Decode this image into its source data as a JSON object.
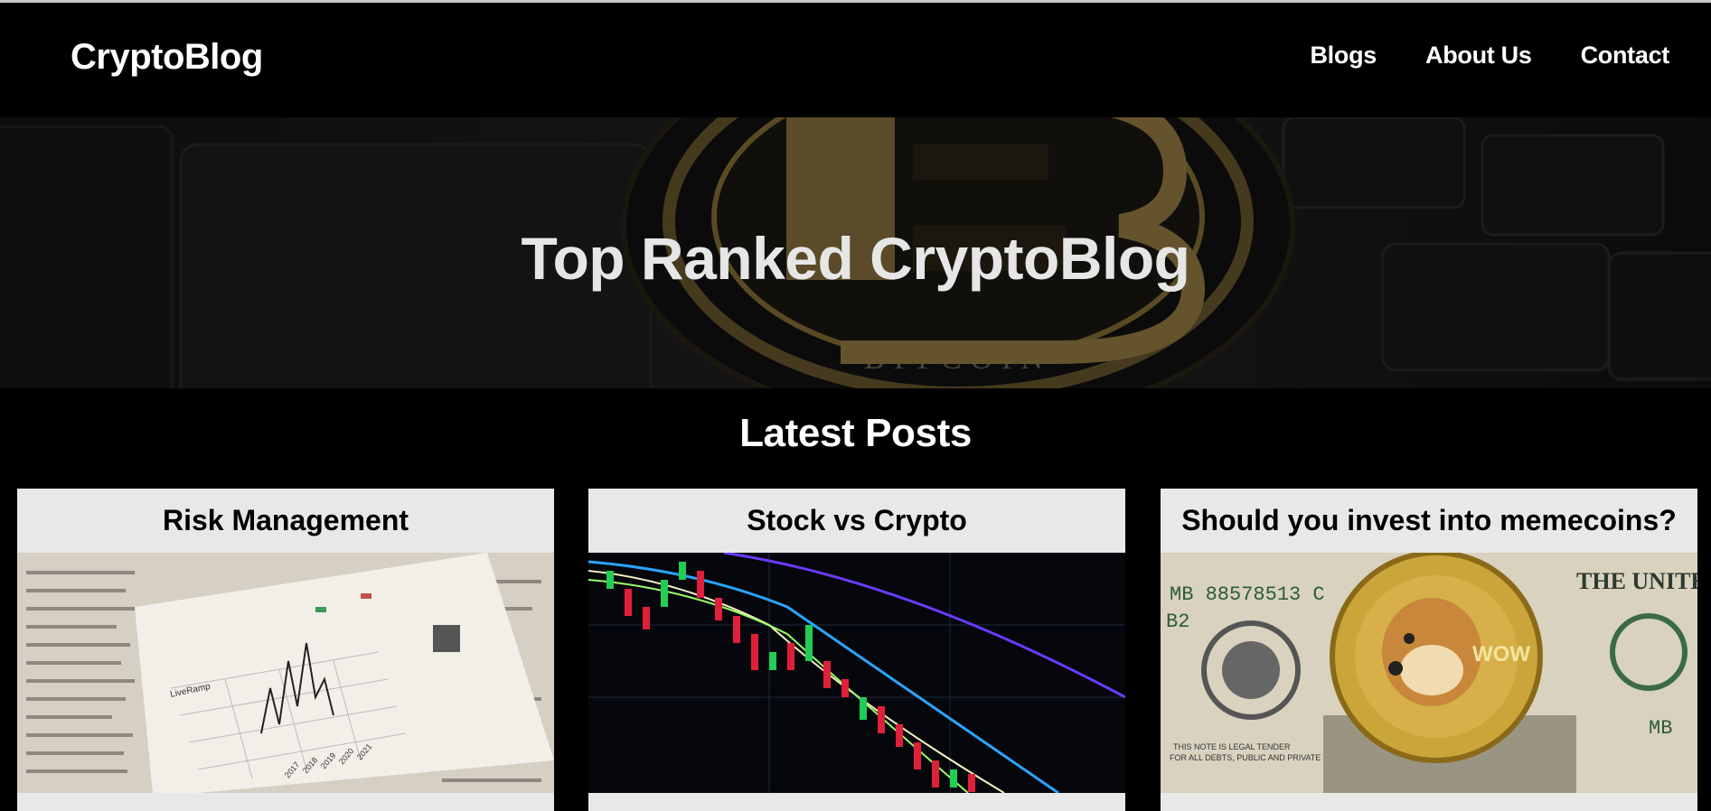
{
  "site": {
    "logo": "CryptoBlog"
  },
  "nav": {
    "items": [
      {
        "label": "Blogs"
      },
      {
        "label": "About Us"
      },
      {
        "label": "Contact"
      }
    ]
  },
  "hero": {
    "title": "Top Ranked CryptoBlog",
    "coin_text": "BITCOIN"
  },
  "latest": {
    "heading": "Latest Posts",
    "posts": [
      {
        "title": "Risk Management"
      },
      {
        "title": "Stock vs Crypto"
      },
      {
        "title": "Should you invest into memecoins?"
      }
    ]
  },
  "images": {
    "newspaper_labels": [
      "LiveRamp",
      "2017",
      "2018",
      "2019",
      "2020",
      "2021"
    ],
    "banknote_text": [
      "MB 88578513 C",
      "B2",
      "THIS NOTE IS LEGAL TENDER",
      "FOR ALL DEBTS, PUBLIC AND PRIVATE",
      "THE UNITED STATES",
      "WOW",
      "MB"
    ]
  },
  "colors": {
    "background": "#000000",
    "card": "#e8e8e8",
    "gold": "#b8963a"
  }
}
